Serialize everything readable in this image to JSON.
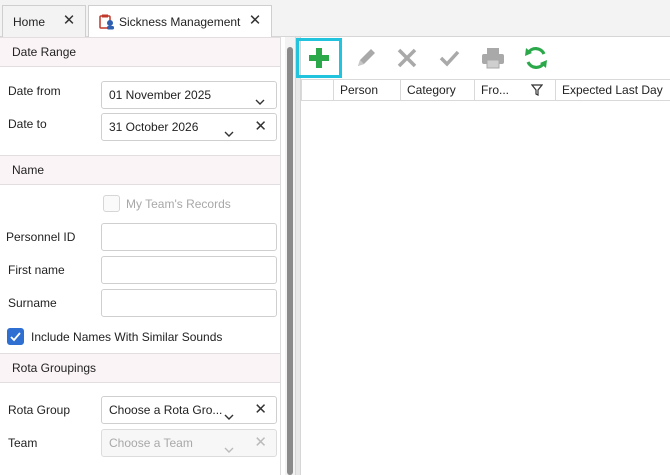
{
  "tabs": [
    {
      "label": "Home",
      "close": "✕"
    },
    {
      "label": "Sickness Management",
      "close": "✕"
    }
  ],
  "filters": {
    "date_range": {
      "header": "Date Range",
      "date_from_label": "Date from",
      "date_from_value": "01 November 2025",
      "date_to_label": "Date to",
      "date_to_value": "31 October 2026"
    },
    "name": {
      "header": "Name",
      "my_team_records_label": "My Team's Records",
      "personnel_id_label": "Personnel ID",
      "personnel_id_value": "",
      "first_name_label": "First name",
      "first_name_value": "",
      "surname_label": "Surname",
      "surname_value": "",
      "include_similar_label": "Include Names With Similar Sounds",
      "include_similar_checked": true
    },
    "rota_groupings": {
      "header": "Rota Groupings",
      "rota_group_label": "Rota Group",
      "rota_group_placeholder": "Choose a Rota Gro...",
      "team_label": "Team",
      "team_placeholder": "Choose a Team"
    }
  },
  "toolbar": {
    "add": "add-icon",
    "edit": "pencil-icon",
    "delete": "x-icon",
    "confirm": "check-icon",
    "print": "printer-icon",
    "refresh": "refresh-icon"
  },
  "grid": {
    "columns": [
      "Person",
      "Category",
      "Fro...",
      "Expected Last Day"
    ]
  },
  "colors": {
    "accent_green": "#2aa84a",
    "highlight": "#22c4dd",
    "section_bg": "#fbf4f6",
    "checkbox_blue": "#2f6fd1"
  }
}
